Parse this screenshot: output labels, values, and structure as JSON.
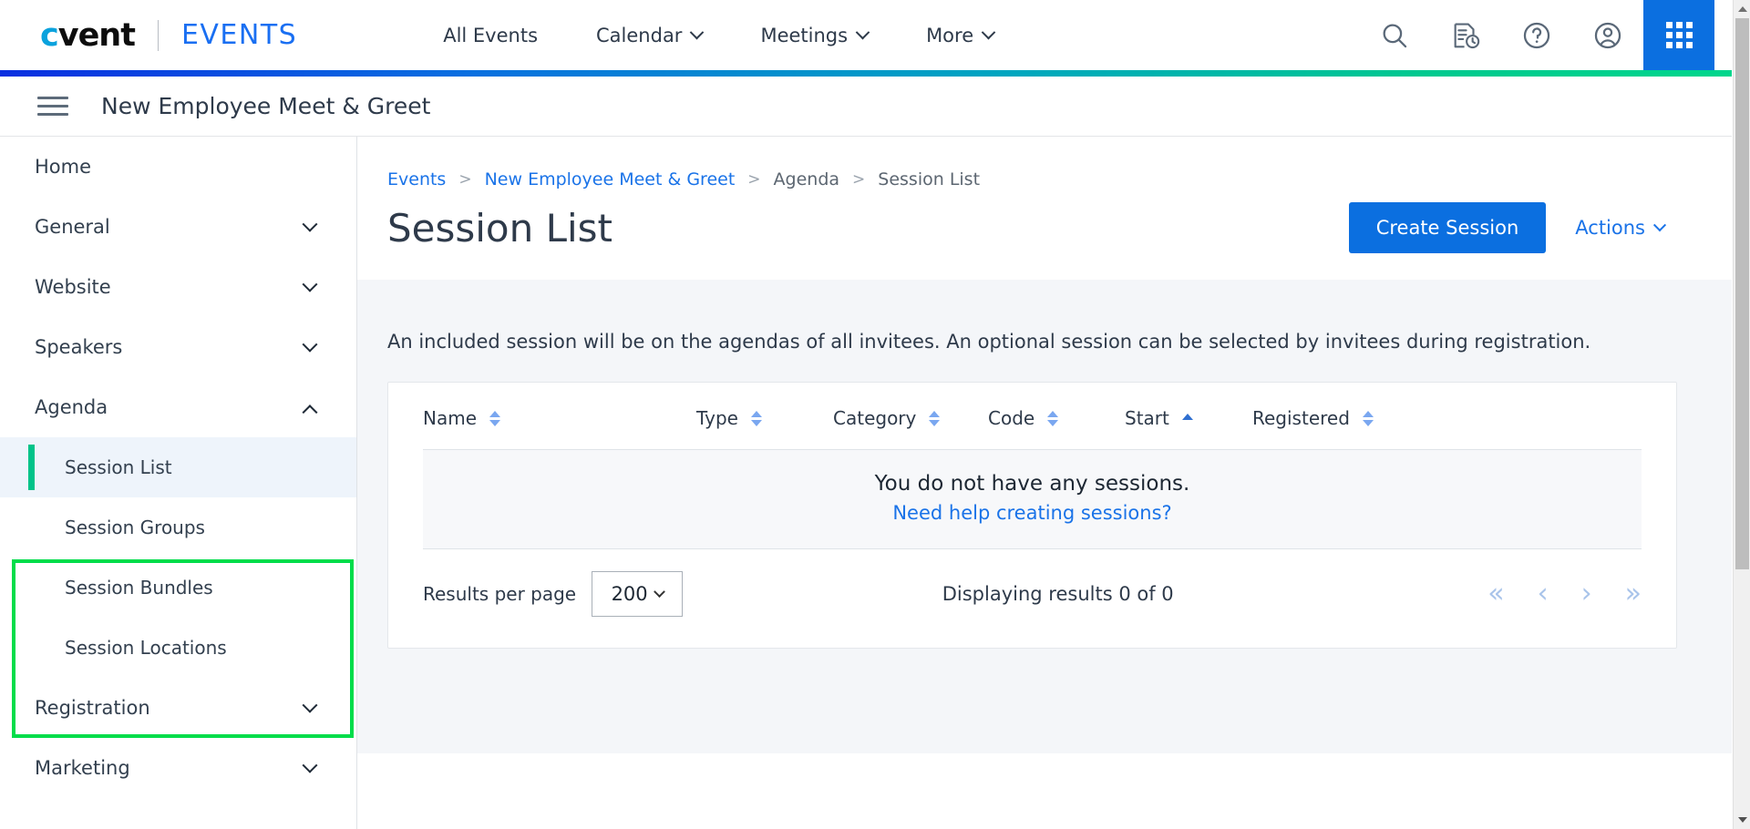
{
  "topnav": {
    "logo_c": "c",
    "logo_rest": "vent",
    "product": "EVENTS",
    "items": [
      {
        "label": "All Events",
        "has_caret": false
      },
      {
        "label": "Calendar",
        "has_caret": true
      },
      {
        "label": "Meetings",
        "has_caret": true
      },
      {
        "label": "More",
        "has_caret": true
      }
    ],
    "icons": [
      {
        "name": "search-icon"
      },
      {
        "name": "report-clock-icon"
      },
      {
        "name": "help-circle-icon"
      },
      {
        "name": "account-circle-icon"
      }
    ],
    "app_launcher": "app-grid-icon",
    "accent_blue": "#0b6fe0"
  },
  "eventbar": {
    "menu_icon": "hamburger-icon",
    "title": "New Employee Meet & Greet"
  },
  "sidebar": {
    "items": [
      {
        "label": "Home",
        "caret": "none"
      },
      {
        "label": "General",
        "caret": "down"
      },
      {
        "label": "Website",
        "caret": "down"
      },
      {
        "label": "Speakers",
        "caret": "down"
      },
      {
        "label": "Agenda",
        "caret": "up"
      }
    ],
    "sub_items": [
      {
        "label": "Session List",
        "active": true
      },
      {
        "label": "Session Groups",
        "active": false
      },
      {
        "label": "Session Bundles",
        "active": false
      },
      {
        "label": "Session Locations",
        "active": false
      }
    ],
    "items_after": [
      {
        "label": "Registration",
        "caret": "down"
      },
      {
        "label": "Marketing",
        "caret": "down"
      }
    ],
    "highlight_color": "#00dd4a",
    "active_accent": "#00c389"
  },
  "breadcrumb": [
    {
      "label": "Events",
      "link": true
    },
    {
      "label": "New Employee Meet & Greet",
      "link": true
    },
    {
      "label": "Agenda",
      "link": false
    },
    {
      "label": "Session List",
      "link": false
    }
  ],
  "page": {
    "title": "Session List",
    "create_button": "Create Session",
    "actions_button": "Actions",
    "note": "An included session will be on the agendas of all invitees. An optional session can be selected by invitees during registration."
  },
  "table": {
    "columns": [
      {
        "label": "Name",
        "sort": "both"
      },
      {
        "label": "Type",
        "sort": "both"
      },
      {
        "label": "Category",
        "sort": "both"
      },
      {
        "label": "Code",
        "sort": "both"
      },
      {
        "label": "Start",
        "sort": "asc"
      },
      {
        "label": "Registered",
        "sort": "both"
      }
    ],
    "rows": [],
    "empty_message": "You do not have any sessions.",
    "empty_link": "Need help creating sessions?"
  },
  "footer": {
    "results_per_page_label": "Results per page",
    "results_per_page_value": "200",
    "displaying": "Displaying results 0 of 0",
    "pager": {
      "first": "«",
      "prev": "‹",
      "next": "›",
      "last": "»"
    }
  }
}
